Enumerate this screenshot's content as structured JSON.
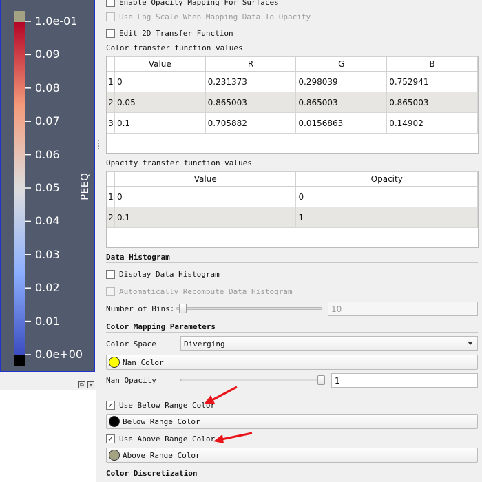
{
  "colorbar": {
    "title": "PEEQ",
    "tick_labels": [
      "1.0e-01",
      "0.09",
      "0.08",
      "0.07",
      "0.06",
      "0.05",
      "0.04",
      "0.03",
      "0.02",
      "0.01",
      "0.0e+00"
    ],
    "colors": {
      "above": "#a3a383",
      "below": "#000000",
      "low": "#3b4cc0",
      "mid": "#dddddd",
      "high": "#b40426",
      "background": "#525a6e"
    }
  },
  "panel": {
    "enable_opacity_label": "Enable Opacity Mapping For Surfaces",
    "log_scale_label": "Use Log Scale When Mapping Data To Opacity",
    "edit_2d_label": "Edit 2D Transfer Function",
    "color_tf_title": "Color transfer function values",
    "color_tf": {
      "headers": [
        "Value",
        "R",
        "G",
        "B"
      ],
      "rows": [
        {
          "idx": "1",
          "cells": [
            "0",
            "0.231373",
            "0.298039",
            "0.752941"
          ]
        },
        {
          "idx": "2",
          "cells": [
            "0.05",
            "0.865003",
            "0.865003",
            "0.865003"
          ]
        },
        {
          "idx": "3",
          "cells": [
            "0.1",
            "0.705882",
            "0.0156863",
            "0.14902"
          ]
        }
      ]
    },
    "opacity_tf_title": "Opacity transfer function values",
    "opacity_tf": {
      "headers": [
        "Value",
        "Opacity"
      ],
      "rows": [
        {
          "idx": "1",
          "cells": [
            "0",
            "0"
          ]
        },
        {
          "idx": "2",
          "cells": [
            "0.1",
            "1"
          ]
        }
      ]
    },
    "data_histogram": {
      "title": "Data Histogram",
      "display_label": "Display Data Histogram",
      "auto_recompute_label": "Automatically Recompute Data Histogram",
      "bins_label": "Number of Bins:",
      "bins_value": "10"
    },
    "color_mapping": {
      "title": "Color Mapping Parameters",
      "color_space_label": "Color Space",
      "color_space_value": "Diverging",
      "nan_color_label": "Nan Color",
      "nan_color": "#ffff00",
      "nan_opacity_label": "Nan Opacity",
      "nan_opacity_value": "1",
      "use_below_label": "Use Below Range Color",
      "below_label": "Below Range Color",
      "below_color": "#000000",
      "use_above_label": "Use Above Range Color",
      "above_label": "Above Range Color",
      "above_color": "#a3a383",
      "check_mark": "✓"
    },
    "color_discretization_title": "Color Discretization"
  }
}
